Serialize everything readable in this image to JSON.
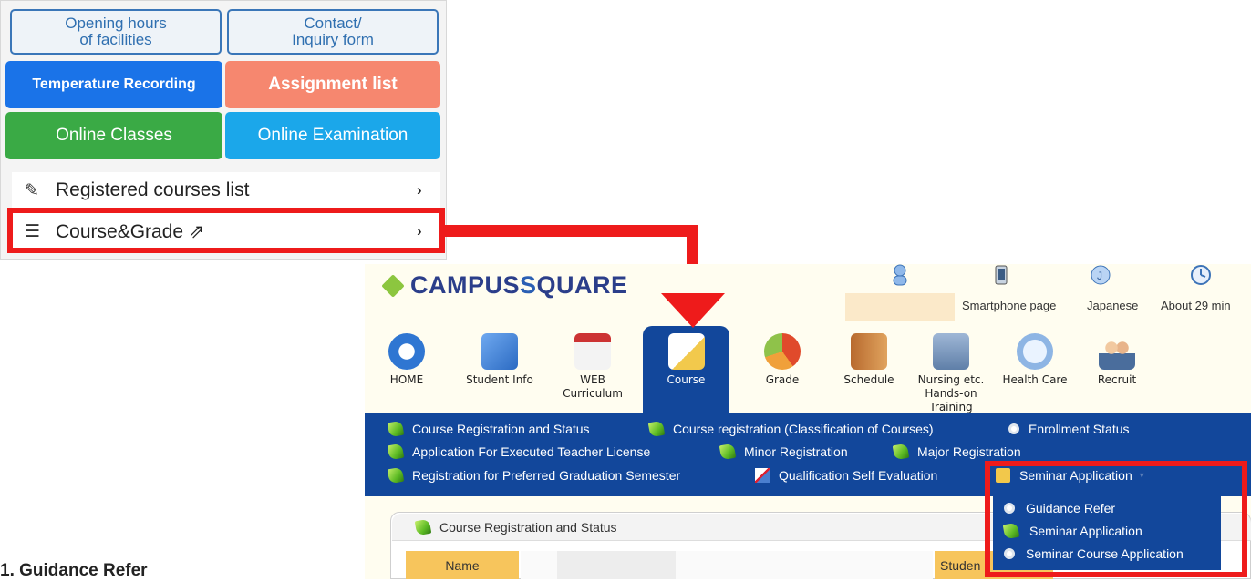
{
  "portal": {
    "btn_hours": "Opening hours\nof facilities",
    "btn_contact": "Contact/\nInquiry form",
    "btn_temp": "Temperature Recording",
    "btn_assign": "Assignment list",
    "btn_online": "Online Classes",
    "btn_exam": "Online Examination",
    "registered": "Registered courses list",
    "course_grade": "Course&Grade",
    "chevron": "›",
    "colors": {
      "temp": "#1a73e8",
      "assign": "#f6876f",
      "online": "#3aaa45",
      "exam": "#1ba7ea"
    }
  },
  "campus": {
    "logo_a": "CAMPUS",
    "logo_b": "S",
    "logo_c": "QUARE",
    "top": {
      "smartphone": "Smartphone page",
      "japanese": "Japanese",
      "about": "About 29 min"
    },
    "nav": [
      {
        "label": "HOME"
      },
      {
        "label": "Student Info"
      },
      {
        "label": "WEB\nCurriculum"
      },
      {
        "label": "Course"
      },
      {
        "label": "Grade"
      },
      {
        "label": "Schedule"
      },
      {
        "label": "Nursing etc.\nHands-on\nTraining"
      },
      {
        "label": "Health Care"
      },
      {
        "label": "Recruit"
      }
    ],
    "subnav": {
      "course_reg": "Course Registration and Status",
      "course_class": "Course registration (Classification of Courses)",
      "enrollment": "Enrollment Status",
      "teacher_license": "Application For Executed Teacher License",
      "minor": "Minor Registration",
      "major": "Major Registration",
      "preferred_grad": "Registration for Preferred Graduation Semester",
      "qualification": "Qualification Self Evaluation",
      "seminar": "Seminar Application"
    },
    "dropdown": {
      "guidance": "Guidance Refer",
      "seminar": "Seminar Application",
      "seminar_course": "Seminar Course Application"
    },
    "content": {
      "header": "Course Registration and Status",
      "name": "Name",
      "student": "Studen"
    }
  },
  "cutoff_text": "1. Guidance Refer"
}
